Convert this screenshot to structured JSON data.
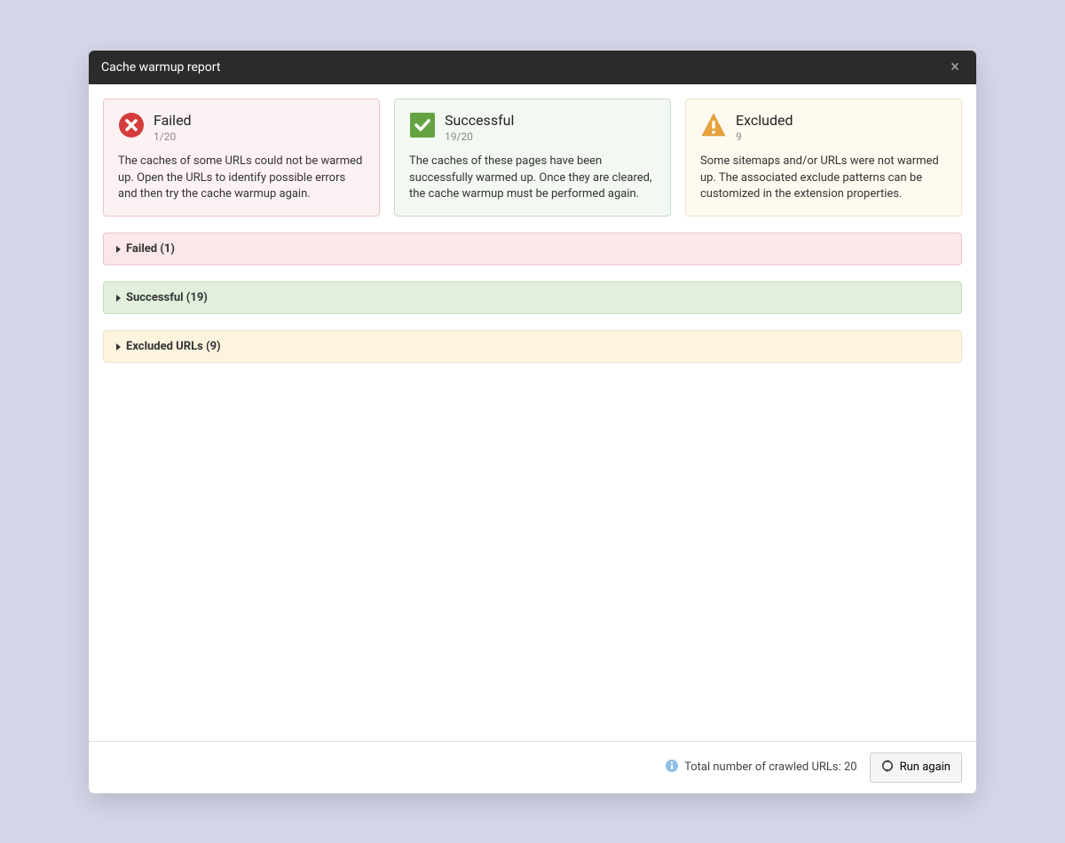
{
  "modal": {
    "title": "Cache warmup report"
  },
  "cards": {
    "failed": {
      "title": "Failed",
      "subtitle": "1/20",
      "description": "The caches of some URLs could not be warmed up. Open the URLs to identify possible errors and then try the cache warmup again."
    },
    "successful": {
      "title": "Successful",
      "subtitle": "19/20",
      "description": "The caches of these pages have been successfully warmed up. Once they are cleared, the cache warmup must be performed again."
    },
    "excluded": {
      "title": "Excluded",
      "subtitle": "9",
      "description": "Some sitemaps and/or URLs were not warmed up. The associated exclude patterns can be customized in the extension properties."
    }
  },
  "accordions": {
    "failed": "Failed (1)",
    "successful": "Successful (19)",
    "excluded": "Excluded URLs (9)"
  },
  "footer": {
    "info": "Total number of crawled URLs: 20",
    "run_again": "Run again"
  }
}
